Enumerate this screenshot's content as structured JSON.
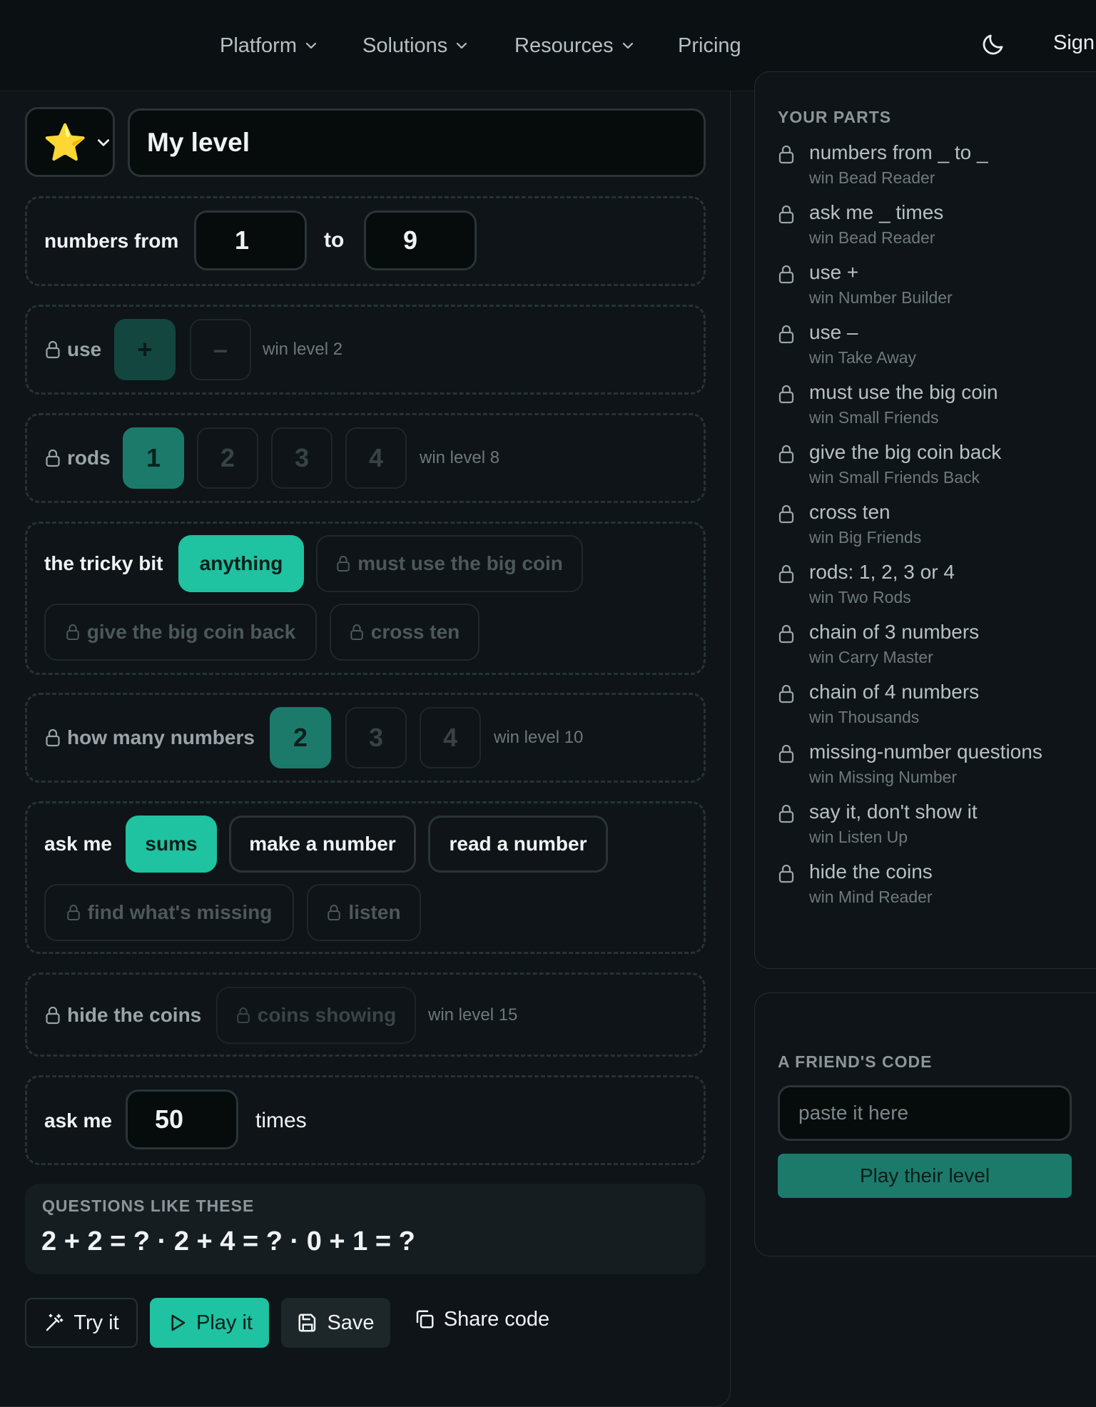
{
  "nav": {
    "items": [
      {
        "label": "Platform"
      },
      {
        "label": "Solutions"
      },
      {
        "label": "Resources"
      },
      {
        "label": "Pricing"
      }
    ],
    "signin": "Sign"
  },
  "editor": {
    "emoji": "⭐",
    "title": "My level",
    "range": {
      "label": "numbers from",
      "from": "1",
      "to_label": "to",
      "to": "9"
    },
    "use": {
      "label": "use",
      "options": [
        "+",
        "–"
      ],
      "hint": "win level 2"
    },
    "rods": {
      "label": "rods",
      "options": [
        "1",
        "2",
        "3",
        "4"
      ],
      "hint": "win level 8"
    },
    "tricky": {
      "label": "the tricky bit",
      "options": [
        "anything",
        "must use the big coin",
        "give the big coin back",
        "cross ten"
      ]
    },
    "count": {
      "label": "how many numbers",
      "options": [
        "2",
        "3",
        "4"
      ],
      "hint": "win level 10"
    },
    "ask": {
      "label": "ask me",
      "options": [
        "sums",
        "make a number",
        "read a number",
        "find what's missing",
        "listen"
      ]
    },
    "hide": {
      "label": "hide the coins",
      "option": "coins showing",
      "hint": "win level 15"
    },
    "times": {
      "label": "ask me",
      "value": "50",
      "suffix": "times"
    },
    "preview": {
      "caption": "QUESTIONS LIKE THESE",
      "text": "2 + 2 = ? · 2 + 4 = ? · 0 + 1 = ?"
    },
    "actions": {
      "try": "Try it",
      "play": "Play it",
      "save": "Save",
      "share": "Share code"
    }
  },
  "parts": {
    "caption": "YOUR PARTS",
    "items": [
      {
        "name": "numbers from _ to _",
        "win": "win Bead Reader"
      },
      {
        "name": "ask me _ times",
        "win": "win Bead Reader"
      },
      {
        "name": "use +",
        "win": "win Number Builder"
      },
      {
        "name": "use –",
        "win": "win Take Away"
      },
      {
        "name": "must use the big coin",
        "win": "win Small Friends"
      },
      {
        "name": "give the big coin back",
        "win": "win Small Friends Back"
      },
      {
        "name": "cross ten",
        "win": "win Big Friends"
      },
      {
        "name": "rods: 1, 2, 3 or 4",
        "win": "win Two Rods"
      },
      {
        "name": "chain of 3 numbers",
        "win": "win Carry Master"
      },
      {
        "name": "chain of 4 numbers",
        "win": "win Thousands"
      },
      {
        "name": "missing-number questions",
        "win": "win Missing Number"
      },
      {
        "name": "say it, don't show it",
        "win": "win Listen Up"
      },
      {
        "name": "hide the coins",
        "win": "win Mind Reader"
      }
    ]
  },
  "friend": {
    "caption": "A FRIEND'S CODE",
    "placeholder": "paste it here",
    "button": "Play their level"
  },
  "colors": {
    "accent": "#1fc2a1",
    "accent_dim": "#1c7a6b",
    "background": "#0e1417"
  }
}
